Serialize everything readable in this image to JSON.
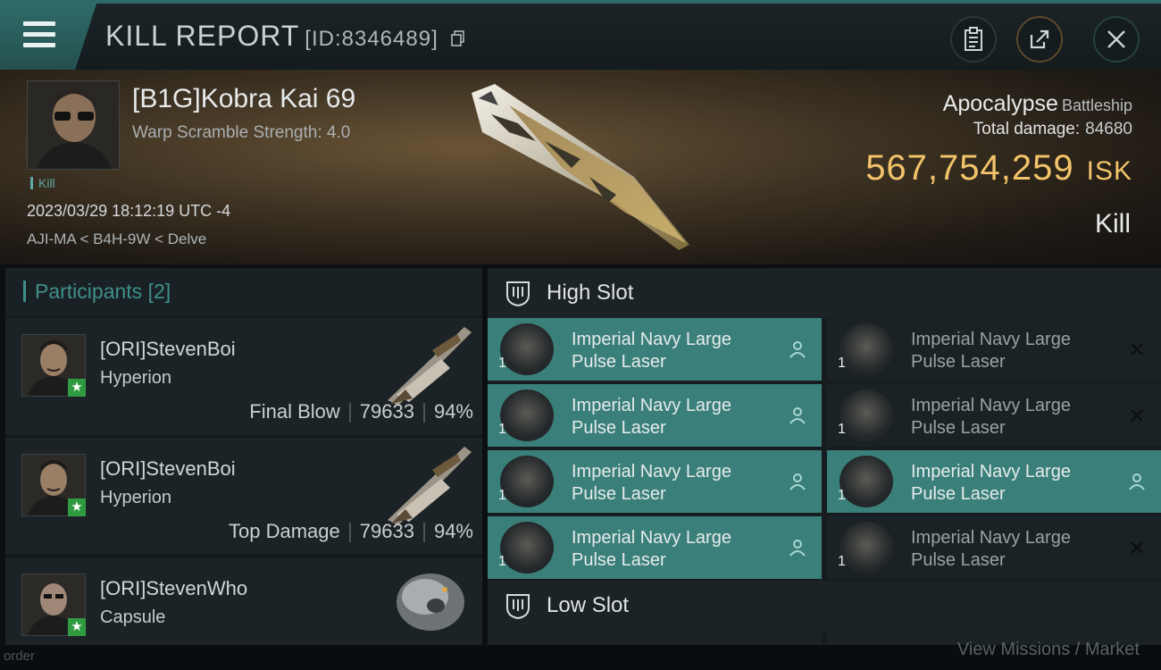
{
  "header": {
    "title": "KILL REPORT",
    "report_id": "[ID:8346489]",
    "icons": [
      "menu-icon",
      "copy-icon",
      "clipboard-icon",
      "share-icon",
      "close-icon"
    ]
  },
  "victim": {
    "name": "[B1G]Kobra Kai 69",
    "warp_scramble": "Warp Scramble Strength: 4.0",
    "tag": "Kill",
    "datetime": "2023/03/29 18:12:19 UTC -4",
    "location": "AJI-MA < B4H-9W < Delve",
    "ship": "Apocalypse",
    "ship_class": "Battleship",
    "total_damage_label": "Total damage:",
    "total_damage": "84680",
    "isk_value": "567,754,259",
    "isk_unit": "ISK",
    "result": "Kill"
  },
  "participants": {
    "label": "Participants",
    "count": "[2]",
    "rows": [
      {
        "name": "[ORI]StevenBoi",
        "ship": "Hyperion",
        "role": "Final Blow",
        "damage": "79633",
        "percent": "94%"
      },
      {
        "name": "[ORI]StevenBoi",
        "ship": "Hyperion",
        "role": "Top Damage",
        "damage": "79633",
        "percent": "94%"
      },
      {
        "name": "[ORI]StevenWho",
        "ship": "Capsule"
      }
    ]
  },
  "fitting": {
    "high_slot_label": "High Slot",
    "low_slot_label": "Low Slot",
    "high_slots": [
      {
        "qty": "1",
        "name": "Imperial Navy Large Pulse Laser",
        "status": "dropped"
      },
      {
        "qty": "1",
        "name": "Imperial Navy Large Pulse Laser",
        "status": "destroyed"
      },
      {
        "qty": "1",
        "name": "Imperial Navy Large Pulse Laser",
        "status": "dropped"
      },
      {
        "qty": "1",
        "name": "Imperial Navy Large Pulse Laser",
        "status": "destroyed"
      },
      {
        "qty": "1",
        "name": "Imperial Navy Large Pulse Laser",
        "status": "dropped"
      },
      {
        "qty": "1",
        "name": "Imperial Navy Large Pulse Laser",
        "status": "dropped"
      },
      {
        "qty": "1",
        "name": "Imperial Navy Large Pulse Laser",
        "status": "dropped"
      },
      {
        "qty": "1",
        "name": "Imperial Navy Large Pulse Laser",
        "status": "destroyed"
      }
    ]
  },
  "footer": {
    "left_text": "order",
    "right_text": "View Missions / Market"
  },
  "colors": {
    "accent": "#3a7f7a",
    "isk": "#f2c36a",
    "star": "#2f9a3f"
  }
}
